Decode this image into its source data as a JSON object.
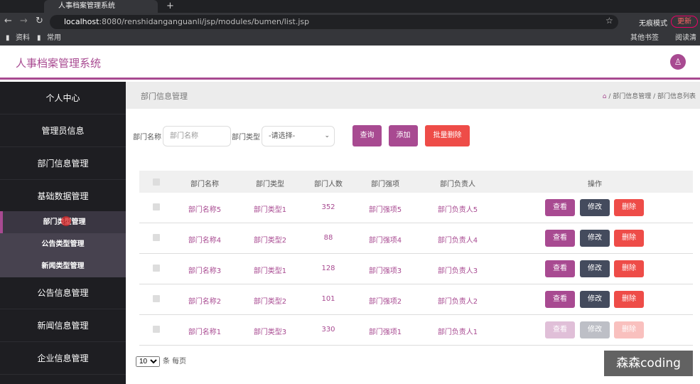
{
  "browser": {
    "tab_title": "人事档案管理系统",
    "url_host": "localhost",
    "url_rest": ":8080/renshidanganguanli/jsp/modules/bumen/list.jsp",
    "incognito_label": "无痕模式",
    "update_label": "更新",
    "bookmarks": [
      "资料",
      "常用"
    ],
    "bookmarks_right": [
      "其他书签",
      "阅读清单"
    ]
  },
  "header": {
    "title": "人事档案管理系统"
  },
  "sidebar": {
    "items": [
      {
        "label": "个人中心"
      },
      {
        "label": "管理员信息"
      },
      {
        "label": "部门信息管理"
      },
      {
        "label": "基础数据管理"
      },
      {
        "label": "部门类型管理"
      },
      {
        "label": "公告类型管理"
      },
      {
        "label": "新闻类型管理"
      },
      {
        "label": "公告信息管理"
      },
      {
        "label": "新闻信息管理"
      },
      {
        "label": "企业信息管理"
      }
    ]
  },
  "page": {
    "title": "部门信息管理",
    "breadcrumb": "/ 部门信息管理 / 部门信息列表"
  },
  "search": {
    "name_label": "部门名称",
    "name_placeholder": "部门名称",
    "type_label": "部门类型",
    "type_value": "-请选择-",
    "query_btn": "查询",
    "add_btn": "添加",
    "batch_delete_btn": "批量删除"
  },
  "table": {
    "headers": [
      "部门名称",
      "部门类型",
      "部门人数",
      "部门强项",
      "部门负责人",
      "操作"
    ],
    "rows": [
      [
        "部门名称5",
        "部门类型1",
        "352",
        "部门强项5",
        "部门负责人5"
      ],
      [
        "部门名称4",
        "部门类型2",
        "88",
        "部门强项4",
        "部门负责人4"
      ],
      [
        "部门名称3",
        "部门类型1",
        "128",
        "部门强项3",
        "部门负责人3"
      ],
      [
        "部门名称2",
        "部门类型2",
        "101",
        "部门强项2",
        "部门负责人2"
      ],
      [
        "部门名称1",
        "部门类型3",
        "330",
        "部门强项1",
        "部门负责人1"
      ]
    ],
    "actions": {
      "view": "查看",
      "edit": "修改",
      "delete": "删除"
    }
  },
  "pager": {
    "page_size": "10",
    "per_page_label": "条 每页"
  },
  "watermark": "森森coding",
  "colors": {
    "accent": "#a84a91",
    "danger": "#ee4c48",
    "dark": "#444b5d",
    "sidebar": "#1e1e22"
  }
}
